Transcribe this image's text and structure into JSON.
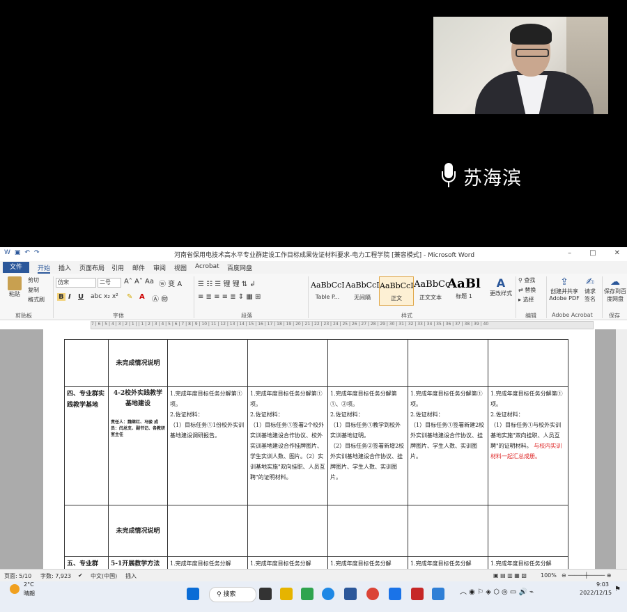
{
  "video": {
    "speaker_name": "苏海滨"
  },
  "word": {
    "window_title": "河南省保用电技术高水平专业群建设工作目标成果佐证材料要求-电力工程学院 [兼容模式] - Microsoft Word",
    "tabs": [
      "文件",
      "开始",
      "插入",
      "页面布局",
      "引用",
      "邮件",
      "审阅",
      "视图",
      "Acrobat",
      "百度网盘"
    ],
    "active_tab": "开始",
    "ribbon": {
      "clipboard": {
        "paste": "粘贴",
        "cut": "剪切",
        "copy": "复制",
        "format_painter": "格式刷",
        "label": "剪贴板"
      },
      "font": {
        "font_name": "仿宋",
        "font_size": "二号",
        "label": "字体"
      },
      "paragraph": {
        "label": "段落"
      },
      "styles": {
        "items": [
          {
            "preview": "AaBbCcI",
            "name": "Table P..."
          },
          {
            "preview": "AaBbCcI",
            "name": "无间隔"
          },
          {
            "preview": "AaBbCcI",
            "name": "正文"
          },
          {
            "preview": "AaBbCc",
            "name": "正文文本"
          },
          {
            "preview": "AaBl",
            "name": "标题 1"
          }
        ],
        "change_styles": "更改样式",
        "label": "样式"
      },
      "editing": {
        "find": "查找",
        "replace": "替换",
        "select": "选择",
        "label": "编辑"
      },
      "acrobat": {
        "create_share": "创建并共享",
        "adobe_pdf": "Adobe PDF",
        "request": "请求",
        "signature": "签名",
        "label": "Adobe Acrobat"
      },
      "save": {
        "save_to": "保存到百",
        "netdisk": "度网盘",
        "label": "保存"
      }
    },
    "ruler_text": "7 | 6 | 5 | 4 | 3 | 2 | 1 |   | 1 | 2 | 3 | 4 | 5 | 6 | 7 | 8 | 9 | 10 | 11 | 12 | 13 | 14 | 15 | 16 | 17 | 18 | 19 | 20 | 21 | 22 | 23 | 24 | 25 | 26 | 27 | 28 | 29 | 30 | 31 | 32 | 33 | 34 | 35 | 36 | 37 | 38 | 39 | 40",
    "table": {
      "row1": {
        "c1": "未完成情况说明"
      },
      "row2": {
        "c0": "四、专业群实践教学基地",
        "c1_title": "4-2校外实践教学基地建设",
        "c1_people": "责任人：魏继红、马骏 成员：闫总支、副书记、各教研室主任",
        "cells": [
          "1.完成年度目标任务分解第①项。\n2.佐证材料：\n（1）目标任务①1份校外实训基地建设调研报告。",
          "1.完成年度目标任务分解第①项。\n2.佐证材料：\n（1）目标任务①签署2个校外实训基地建设合作协议、校外实训基地建设合作挂牌图片、学生实训人数、图片。（2）实训基地实施\"双向挂职、人员互聘\"的证明材料。",
          "1.完成年度目标任务分解第①、②项。\n2.佐证材料：\n（1）目标任务①教学到校外实训基地证明。\n（2）目标任务②签署新增2校外实训基地建设合作协议、挂牌图片、学生人数、实训图片。",
          "1.完成年度目标任务分解第①项。\n2.佐证材料：\n（1）目标任务①签署新建2校外实训基地建设合作协议、挂牌图片、学生人数、实训图片。"
        ],
        "last_cell": "1.完成年度目标任务分解第①项。\n2.佐证材料：\n（1）目标任务①与校外实训基地实施\"双向挂职、人员互聘\"的证明材料。",
        "last_cell_red": "与校内实训材料一起汇总成册。"
      },
      "row3": {
        "c1": "未完成情况说明"
      },
      "row4": {
        "c0": "五、专业群",
        "c1": "5-1开展教学方法",
        "cell": "1.完成年度目标任务分解"
      }
    },
    "status": {
      "page": "页面: 5/10",
      "words": "字数: 7,923",
      "language": "中文(中国)",
      "mode": "插入",
      "zoom": "100%"
    }
  },
  "taskbar": {
    "weather_temp": "2°C",
    "weather_desc": "晴朗",
    "search": "搜索",
    "time": "9:03",
    "date": "2022/12/15"
  }
}
